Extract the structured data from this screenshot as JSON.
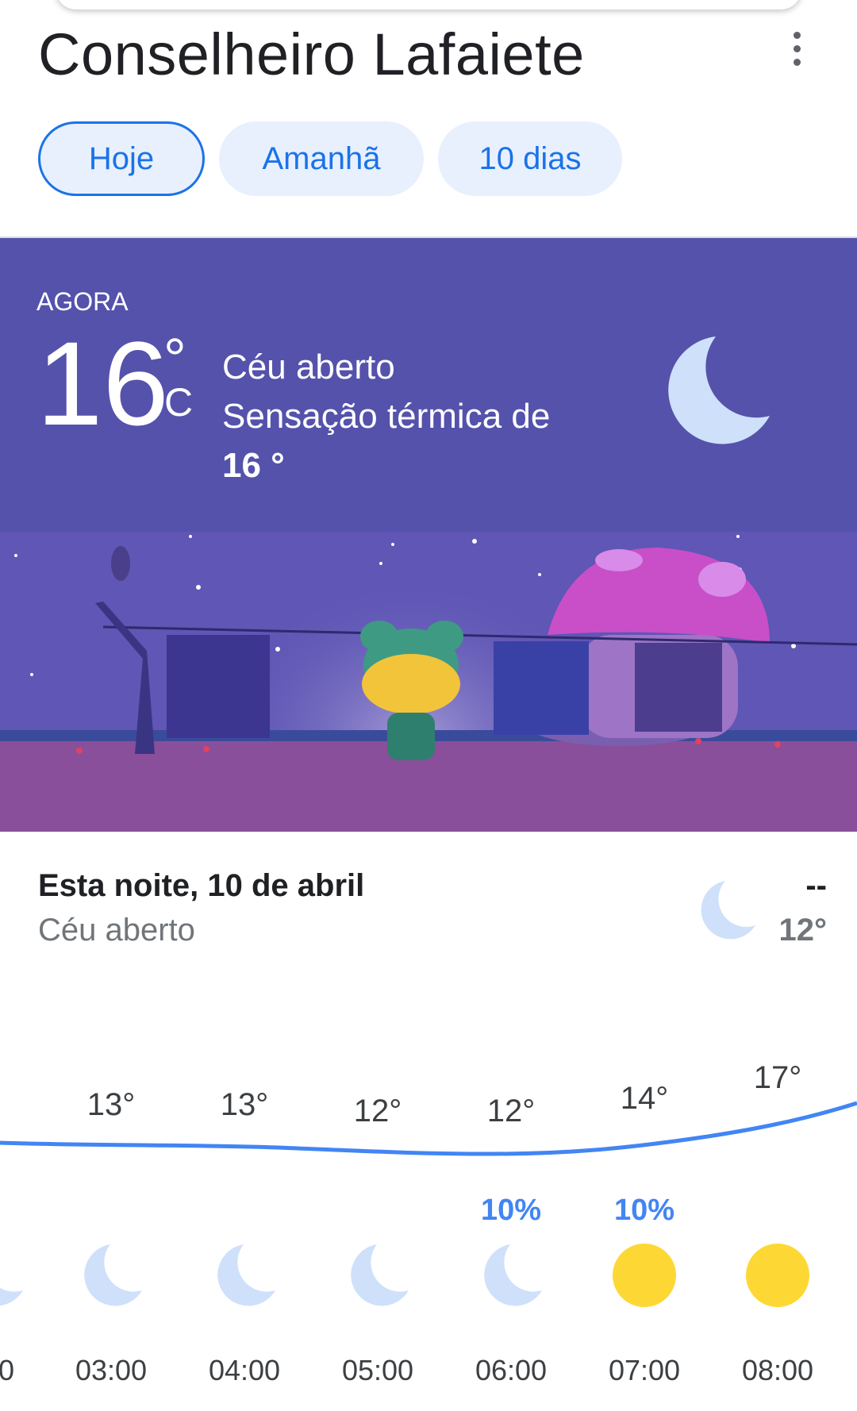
{
  "header": {
    "city": "Conselheiro Lafaiete"
  },
  "tabs": [
    {
      "label": "Hoje"
    },
    {
      "label": "Amanhã"
    },
    {
      "label": "10 dias"
    }
  ],
  "now": {
    "label": "AGORA",
    "temp": "16",
    "deg": "°",
    "unit": "C",
    "condition": "Céu aberto",
    "feels_like_prefix": "Sensação térmica de",
    "feels_like_value": "16 °"
  },
  "tonight": {
    "title": "Esta noite, 10 de abril",
    "condition": "Céu aberto",
    "high": "--",
    "low": "12°"
  },
  "hourly": [
    {
      "time": "0",
      "temp": "",
      "precip": "",
      "icon": "moon-icon"
    },
    {
      "time": "03:00",
      "temp": "13°",
      "precip": "",
      "icon": "moon-icon"
    },
    {
      "time": "04:00",
      "temp": "13°",
      "precip": "",
      "icon": "moon-icon"
    },
    {
      "time": "05:00",
      "temp": "12°",
      "precip": "",
      "icon": "moon-icon"
    },
    {
      "time": "06:00",
      "temp": "12°",
      "precip": "10%",
      "icon": "moon-icon"
    },
    {
      "time": "07:00",
      "temp": "14°",
      "precip": "10%",
      "icon": "sun-icon"
    },
    {
      "time": "08:00",
      "temp": "17°",
      "precip": "",
      "icon": "sun-icon"
    }
  ],
  "colors": {
    "accent": "#1a73e8",
    "hero_bg": "#5552ac",
    "sun": "#fdd835",
    "moon": "#cfe0fb"
  }
}
